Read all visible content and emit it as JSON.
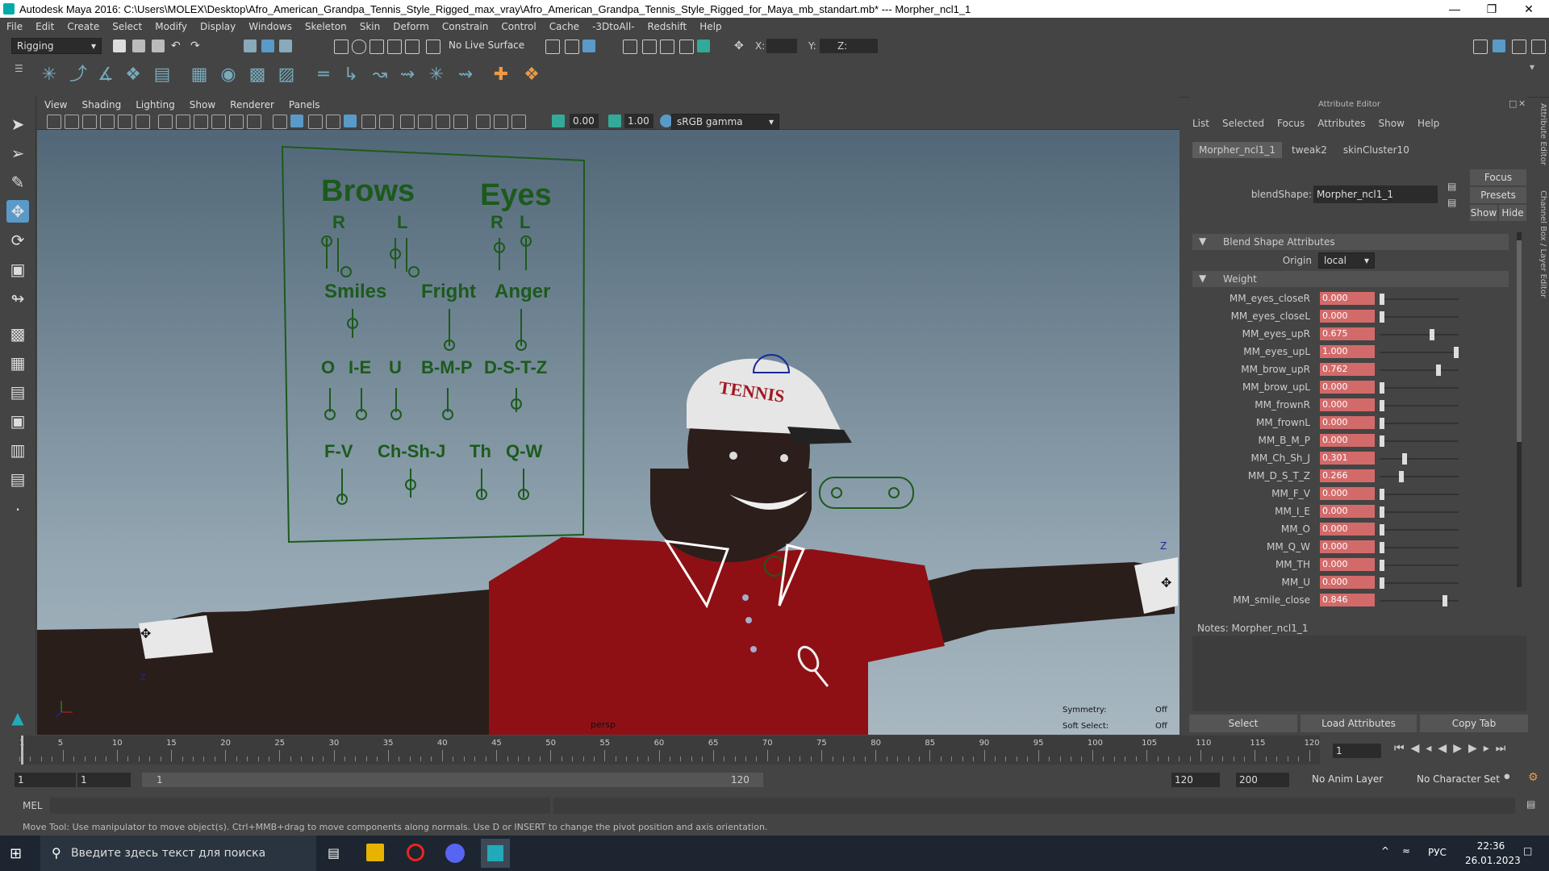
{
  "window": {
    "title": "Autodesk Maya 2016: C:\\Users\\MOLEX\\Desktop\\Afro_American_Grandpa_Tennis_Style_Rigged_max_vray\\Afro_American_Grandpa_Tennis_Style_Rigged_for_Maya_mb_standart.mb*  ---  Morpher_ncl1_1"
  },
  "menubar": [
    "File",
    "Edit",
    "Create",
    "Select",
    "Modify",
    "Display",
    "Windows",
    "Skeleton",
    "Skin",
    "Deform",
    "Constrain",
    "Control",
    "Cache",
    "-3DtoAll-",
    "Redshift",
    "Help"
  ],
  "statusline": {
    "mode": "Rigging",
    "live_surface": "No Live Surface",
    "x_label": "X:",
    "y_label": "Y:",
    "z_label": "Z:"
  },
  "viewport": {
    "menu": [
      "View",
      "Shading",
      "Lighting",
      "Show",
      "Renderer",
      "Panels"
    ],
    "exposure": "0.00",
    "gamma": "1.00",
    "color_space": "sRGB gamma",
    "camera": "persp",
    "symmetry_label": "Symmetry:",
    "symmetry_value": "Off",
    "softselect_label": "Soft Select:",
    "softselect_value": "Off",
    "axis_z": "z",
    "axis_z2": "Z",
    "cap_text": "TENNIS",
    "board": {
      "brows": "Brows",
      "eyes": "Eyes",
      "r1": "R",
      "l1": "L",
      "r2": "R",
      "l2": "L",
      "smiles": "Smiles",
      "fright": "Fright",
      "anger": "Anger",
      "o": "O",
      "ie": "I-E",
      "u": "U",
      "bmp": "B-M-P",
      "dstz": "D-S-T-Z",
      "fv": "F-V",
      "chshj": "Ch-Sh-J",
      "th": "Th",
      "qw": "Q-W"
    }
  },
  "attribute_editor": {
    "header": "Attribute Editor",
    "menu": [
      "List",
      "Selected",
      "Focus",
      "Attributes",
      "Show",
      "Help"
    ],
    "tabs": [
      "Morpher_ncl1_1",
      "tweak2",
      "skinCluster10"
    ],
    "blendshape_label": "blendShape:",
    "blendshape_value": "Morpher_ncl1_1",
    "focus_btn": "Focus",
    "presets_btn": "Presets",
    "show_btn": "Show",
    "hide_btn": "Hide",
    "section_blend": "Blend Shape Attributes",
    "origin_label": "Origin",
    "origin_value": "local",
    "section_weight": "Weight",
    "weights": [
      {
        "name": "MM_eyes_closeR",
        "value": "0.000",
        "level": 0
      },
      {
        "name": "MM_eyes_closeL",
        "value": "0.000",
        "level": 0
      },
      {
        "name": "MM_eyes_upR",
        "value": "0.675",
        "level": 0.675
      },
      {
        "name": "MM_eyes_upL",
        "value": "1.000",
        "level": 1
      },
      {
        "name": "MM_brow_upR",
        "value": "0.762",
        "level": 0.762
      },
      {
        "name": "MM_brow_upL",
        "value": "0.000",
        "level": 0
      },
      {
        "name": "MM_frownR",
        "value": "0.000",
        "level": 0
      },
      {
        "name": "MM_frownL",
        "value": "0.000",
        "level": 0
      },
      {
        "name": "MM_B_M_P",
        "value": "0.000",
        "level": 0
      },
      {
        "name": "MM_Ch_Sh_J",
        "value": "0.301",
        "level": 0.301
      },
      {
        "name": "MM_D_S_T_Z",
        "value": "0.266",
        "level": 0.266
      },
      {
        "name": "MM_F_V",
        "value": "0.000",
        "level": 0
      },
      {
        "name": "MM_I_E",
        "value": "0.000",
        "level": 0
      },
      {
        "name": "MM_O",
        "value": "0.000",
        "level": 0
      },
      {
        "name": "MM_Q_W",
        "value": "0.000",
        "level": 0
      },
      {
        "name": "MM_TH",
        "value": "0.000",
        "level": 0
      },
      {
        "name": "MM_U",
        "value": "0.000",
        "level": 0
      },
      {
        "name": "MM_smile_close",
        "value": "0.846",
        "level": 0.846
      }
    ],
    "notes_label": "Notes:  Morpher_ncl1_1",
    "select_btn": "Select",
    "load_btn": "Load Attributes",
    "copy_btn": "Copy Tab",
    "side_tab1": "Attribute Editor",
    "side_tab2": "Channel Box / Layer Editor"
  },
  "timeline": {
    "ticks": [
      "5",
      "10",
      "15",
      "20",
      "25",
      "30",
      "35",
      "40",
      "45",
      "50",
      "55",
      "60",
      "65",
      "70",
      "75",
      "80",
      "85",
      "90",
      "95",
      "100",
      "105",
      "110",
      "115",
      "120"
    ],
    "start_tick": "1",
    "current_frame": "1"
  },
  "range": {
    "start": "1",
    "start2": "1",
    "slider_start": "1",
    "slider_end": "120",
    "end": "120",
    "end2": "200",
    "anim_layer": "No Anim Layer",
    "char_set": "No Character Set"
  },
  "cmdline": {
    "label": "MEL"
  },
  "helpline": {
    "text": "Move Tool: Use manipulator to move object(s). Ctrl+MMB+drag to move components along normals. Use D or INSERT to change the pivot position and axis orientation."
  },
  "taskbar": {
    "search_placeholder": "Введите здесь текст для поиска",
    "lang": "РУС",
    "time": "22:36",
    "date": "26.01.2023"
  }
}
